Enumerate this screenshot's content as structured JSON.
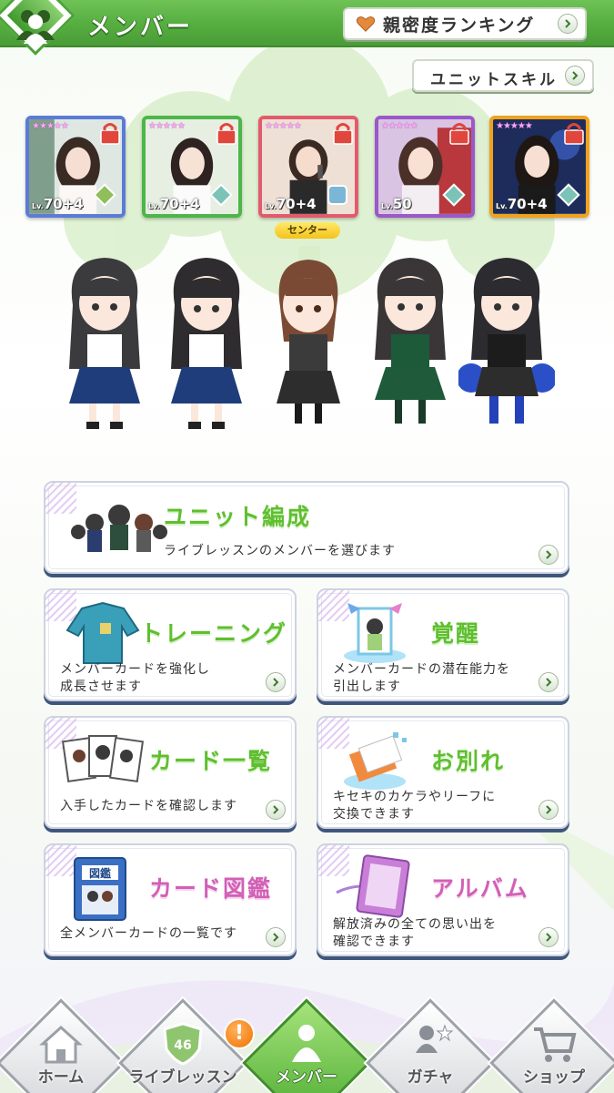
{
  "header": {
    "title": "メンバー",
    "ranking_label": "親密度ランキング"
  },
  "unit_skill_label": "ユニットスキル",
  "cards": [
    {
      "stars": "★★★★★",
      "level_prefix": "Lv.",
      "level": "70+4",
      "frame_color": "#5b7bd6",
      "locked": true
    },
    {
      "stars": "★★★★★",
      "level_prefix": "Lv.",
      "level": "70+4",
      "frame_color": "#4cb64a",
      "locked": true
    },
    {
      "stars": "★★★★★",
      "level_prefix": "Lv.",
      "level": "70+4",
      "frame_color": "#e25b6c",
      "locked": true
    },
    {
      "stars": "★★★★★",
      "level_prefix": "Lv.",
      "level": "50",
      "frame_color": "#9a58c9",
      "locked": true
    },
    {
      "stars": "★★★★★",
      "level_prefix": "Lv.",
      "level": "70+4",
      "frame_color": "#f0a21e",
      "locked": true
    }
  ],
  "center_label": "センター",
  "menu": {
    "unit": {
      "title": "ユニット編成",
      "desc": "ライブレッスンのメンバーを選びます"
    },
    "training": {
      "title": "トレーニング",
      "desc1": "メンバーカードを強化し",
      "desc2": "成長させます"
    },
    "awaken": {
      "title": "覚醒",
      "desc1": "メンバーカードの潜在能力を",
      "desc2": "引出します"
    },
    "card_list": {
      "title": "カード一覧",
      "desc1": "入手したカードを確認します"
    },
    "farewell": {
      "title": "お別れ",
      "desc1": "キセキのカケラやリーフに",
      "desc2": "交換できます"
    },
    "encyclopedia": {
      "title": "カード図鑑",
      "desc1": "全メンバーカードの一覧です",
      "book_label": "図鑑"
    },
    "album": {
      "title": "アルバム",
      "desc1": "解放済みの全ての思い出を",
      "desc2": "確認できます"
    }
  },
  "nav": {
    "home": "ホーム",
    "live_lesson": "ライブレッスン",
    "member": "メンバー",
    "gacha": "ガチャ",
    "shop": "ショップ",
    "alert": "!",
    "shield_number": "46"
  },
  "colors": {
    "header_green": "#55ad3f",
    "title_green": "#5fbf2f",
    "title_pink": "#d160b6",
    "panel_shadow": "#3f567c"
  }
}
